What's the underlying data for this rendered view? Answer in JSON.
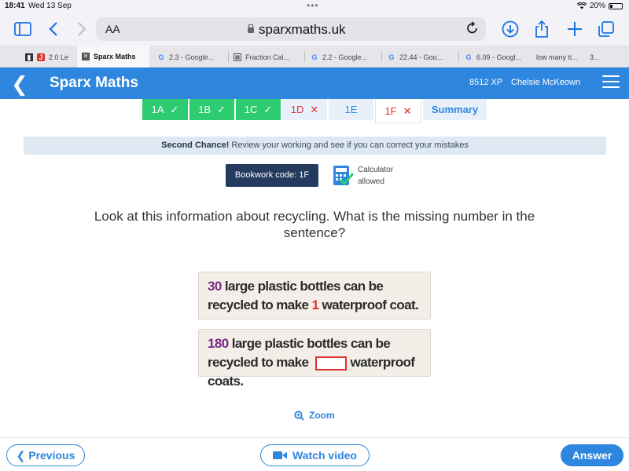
{
  "status_bar": {
    "time": "18:41",
    "date": "Wed 13 Sep",
    "battery": "20%",
    "wifi_icon": "wifi-icon",
    "battery_icon": "battery-icon"
  },
  "browser": {
    "text_size_label": "AA",
    "url": "sparxmaths.uk",
    "icons": [
      "sidebar-icon",
      "back-icon",
      "forward-icon",
      "lock-icon",
      "reload-icon",
      "download-icon",
      "share-icon",
      "new-tab-icon",
      "tabs-icon"
    ]
  },
  "tabs": [
    {
      "label": "2.0 Le"
    },
    {
      "label": "Sparx Maths"
    },
    {
      "label": "2.3 - Google..."
    },
    {
      "label": "Fraction Cal..."
    },
    {
      "label": "2.2 - Google..."
    },
    {
      "label": "22.44  - Goo..."
    },
    {
      "label": "6.09 - Googl..."
    },
    {
      "label": "low many ti..."
    },
    {
      "label": "3..."
    }
  ],
  "header": {
    "brand": "Sparx Maths",
    "xp": "8512 XP",
    "user": "Chelsie McKeown"
  },
  "task_tabs": [
    {
      "label": "1A",
      "mark": "✓"
    },
    {
      "label": "1B",
      "mark": "✓"
    },
    {
      "label": "1C",
      "mark": "✓"
    },
    {
      "label": "1D",
      "mark": "✕"
    },
    {
      "label": "1E",
      "mark": ""
    },
    {
      "label": "1F",
      "mark": "✕"
    },
    {
      "label": "Summary",
      "mark": ""
    }
  ],
  "banner": {
    "bold": "Second Chance!",
    "text": " Review your working and see if you can correct your mistakes"
  },
  "bookwork": {
    "label": "Bookwork code: 1F"
  },
  "calculator": {
    "line1": "Calculator",
    "line2": "allowed"
  },
  "question": {
    "text": "Look at this information about recycling. What is the missing number in the sentence?"
  },
  "info_cards": [
    {
      "num": "30",
      "text_a": " large plastic bottles can be recycled to make ",
      "num2": "1",
      "text_b": " waterproof coat."
    },
    {
      "num": "180",
      "text_a": " large plastic bottles can be recycled to make ",
      "text_b": "waterproof coats."
    }
  ],
  "zoom": {
    "label": "Zoom"
  },
  "buttons": {
    "previous": "Previous",
    "watch_video": "Watch video",
    "answer": "Answer"
  },
  "colors": {
    "brand_blue": "#2e86de",
    "done_green": "#2ecc71",
    "error_red": "#e0302f",
    "number_purple": "#7b2a83",
    "bookwork_navy": "#243a5e"
  }
}
